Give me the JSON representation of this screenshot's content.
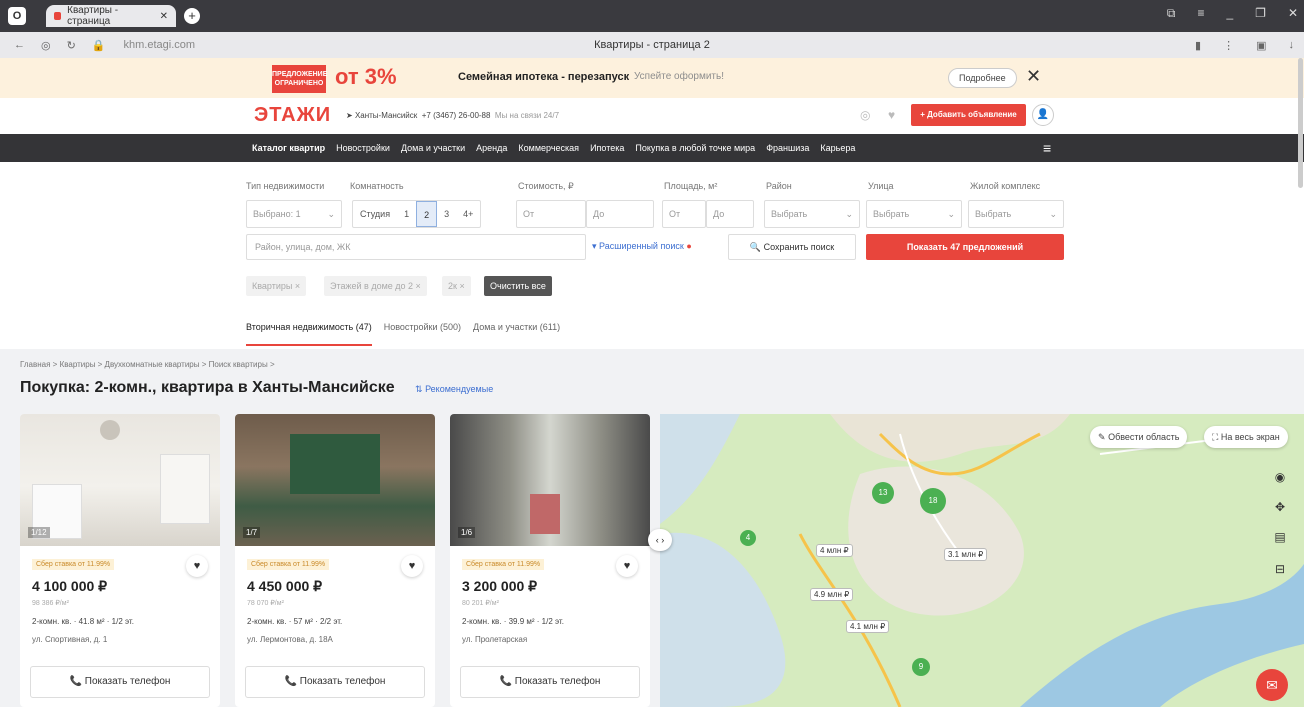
{
  "browser": {
    "tab_title": "Квартиры - страница",
    "url": "khm.etagi.com",
    "page_title": "Квартиры - страница 2"
  },
  "promo": {
    "badge": "ПРЕДЛОЖЕНИЕ ОГРАНИЧЕНО",
    "big": "от 3%",
    "title": "Семейная ипотека - перезапуск",
    "subtitle": "Успейте оформить!",
    "more": "Подробнее",
    "close": "✕"
  },
  "header": {
    "logo": "ЭТАЖИ",
    "city": "Ханты-Мансийск",
    "phone": "+7 (3467) 26-00-88",
    "online": "Мы на связи 24/7",
    "add_button": "+ Добавить объявление"
  },
  "nav": [
    "Каталог квартир",
    "Новостройки",
    "Дома и участки",
    "Аренда",
    "Коммерческая",
    "Ипотека",
    "Покупка в любой точке мира",
    "Франшиза",
    "Карьера"
  ],
  "filters": {
    "labels": {
      "type": "Тип недвижимости",
      "rooms": "Комнатность",
      "cost": "Стоимость, ₽",
      "area": "Площадь, м²",
      "district": "Район",
      "street": "Улица",
      "complex": "Жилой комплекс"
    },
    "type_value": "Выбрано: 1",
    "rooms": [
      "Студия",
      "1",
      "2",
      "3",
      "4+"
    ],
    "cost_from": "От",
    "cost_to": "До",
    "area_from": "От",
    "area_to": "До",
    "district": "Выбрать",
    "street": "Выбрать",
    "complex": "Выбрать",
    "search_placeholder": "Район, улица, дом, ЖК",
    "extended": "Расширенный поиск",
    "save": "Сохранить поиск",
    "show": "Показать 47 предложений"
  },
  "chips": [
    "Квартиры ×",
    "Этажей в доме до 2 ×",
    "2к ×",
    "Очистить все"
  ],
  "subtabs": [
    "Вторичная недвижимость (47)",
    "Новостройки (500)",
    "Дома и участки (611)"
  ],
  "breadcrumb": "Главная  >  Квартиры  >  Двухкомнатные квартиры  >  Поиск квартиры  >",
  "heading": "Покупка: 2-комн., квартира в Ханты-Мансийске",
  "sort": "Рекомендуемые",
  "cards": [
    {
      "count": "1/12",
      "badge": "Сбер ставка от 11.99%",
      "price": "4 100 000 ₽",
      "ppm": "98 386 ₽/м²",
      "info": "2-комн. кв.  ·  41.8 м²  ·  1/2 эт.",
      "address": "ул. Спортивная, д. 1",
      "phone": "Показать телефон"
    },
    {
      "count": "1/7",
      "badge": "Сбер ставка от 11.99%",
      "price": "4 450 000 ₽",
      "ppm": "78 070 ₽/м²",
      "info": "2-комн. кв.  ·  57 м²  ·  2/2 эт.",
      "address": "ул. Лермонтова, д. 18А",
      "phone": "Показать телефон"
    },
    {
      "count": "1/6",
      "badge": "Сбер ставка от 11.99%",
      "price": "3 200 000 ₽",
      "ppm": "80 201 ₽/м²",
      "info": "2-комн. кв.  ·  39.9 м²  ·  1/2 эт.",
      "address": "ул. Пролетарская",
      "phone": "Показать телефон"
    }
  ],
  "map": {
    "draw_area": "Обвести область",
    "fullscreen": "На весь экран",
    "pins": [
      "13",
      "18",
      "4",
      "9"
    ],
    "labels": [
      "4 млн ₽",
      "3.1 млн ₽",
      "4.9 млн ₽",
      "4.1 млн ₽"
    ]
  }
}
